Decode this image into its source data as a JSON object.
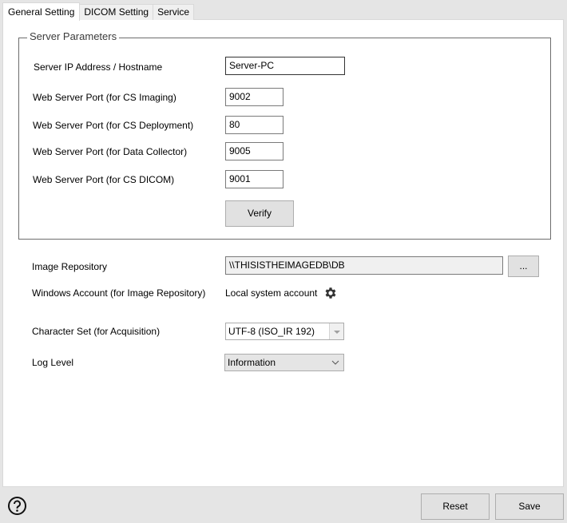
{
  "tabs": [
    {
      "label": "General Setting",
      "active": true
    },
    {
      "label": "DICOM Setting",
      "active": false
    },
    {
      "label": "Service",
      "active": false
    }
  ],
  "server_parameters": {
    "title": "Server Parameters",
    "fields": [
      {
        "label": "Server IP Address / Hostname",
        "value": "Server-PC"
      },
      {
        "label": "Web Server Port (for CS Imaging)",
        "value": "9002"
      },
      {
        "label": "Web Server Port (for CS Deployment)",
        "value": "80"
      },
      {
        "label": "Web Server Port (for Data Collector)",
        "value": "9005"
      },
      {
        "label": "Web Server Port (for CS DICOM)",
        "value": "9001"
      }
    ],
    "verify_label": "Verify"
  },
  "image_repository": {
    "label": "Image Repository",
    "value": "\\\\THISISTHEIMAGEDB\\DB",
    "browse_label": "..."
  },
  "windows_account": {
    "label": "Windows Account (for Image Repository)",
    "value": "Local system account",
    "icon": "gear-icon"
  },
  "character_set": {
    "label": "Character Set (for Acquisition)",
    "selected": "UTF-8 (ISO_IR 192)"
  },
  "log_level": {
    "label": "Log Level",
    "selected": "Information"
  },
  "footer": {
    "help_icon": "help-icon",
    "reset_label": "Reset",
    "save_label": "Save"
  }
}
